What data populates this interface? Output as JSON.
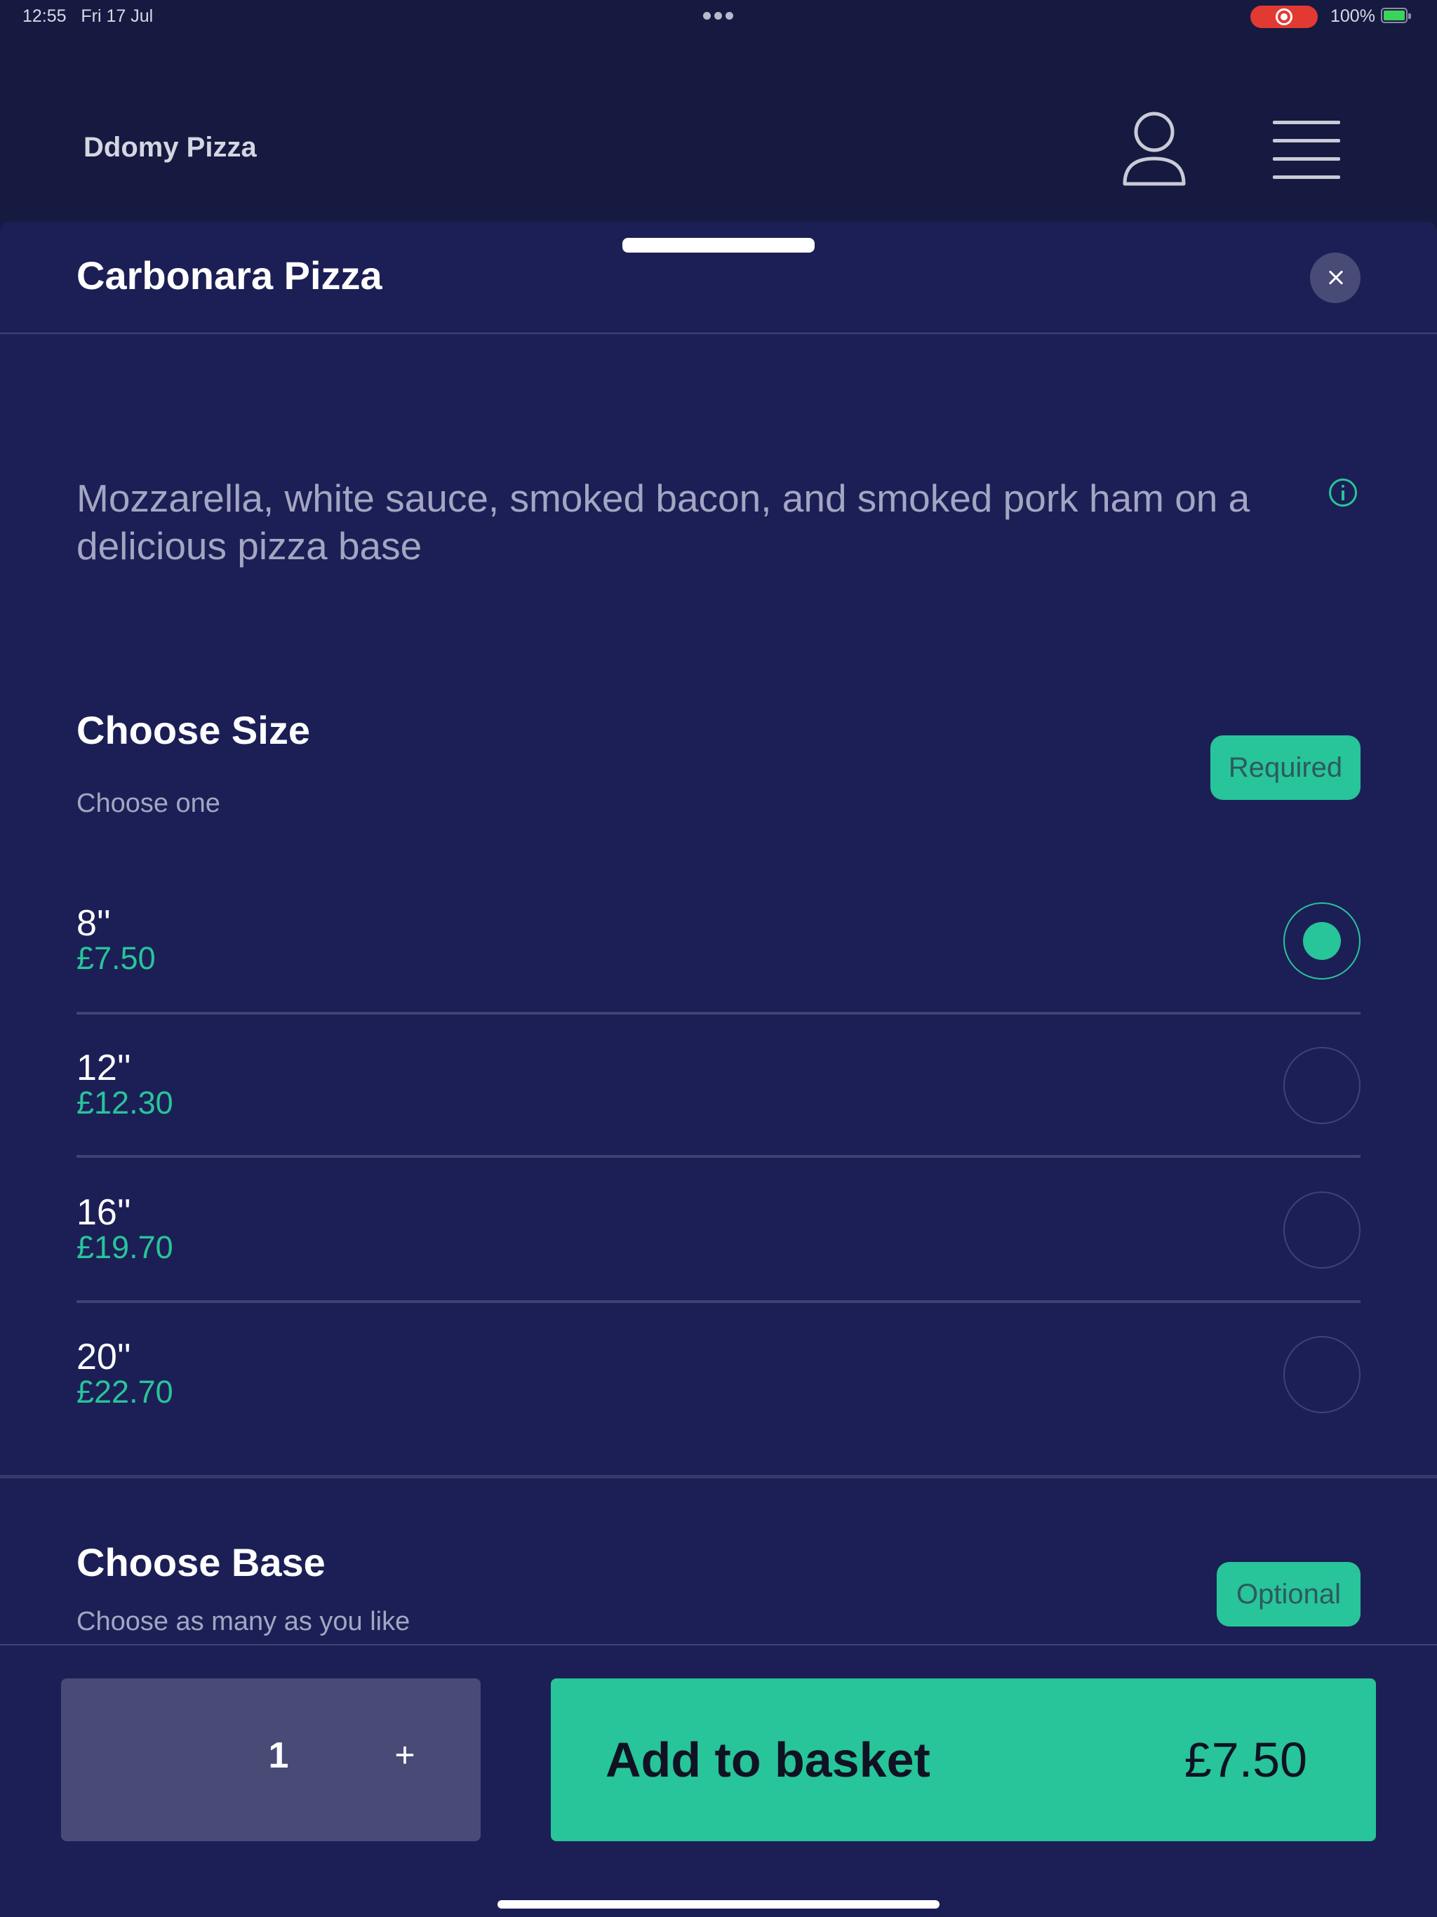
{
  "status_bar": {
    "time": "12:55",
    "date": "Fri 17 Jul",
    "battery_percent": "100%",
    "battery_level": 1.0
  },
  "app": {
    "brand": "Ddomy Pizza",
    "profile_icon": "user-icon",
    "menu_icon": "hamburger-menu-icon"
  },
  "item": {
    "title": "Carbonara Pizza",
    "description": "Mozzarella, white sauce, smoked bacon, and smoked pork ham on a delicious pizza base"
  },
  "size_section": {
    "title": "Choose Size",
    "subtitle": "Choose one",
    "badge": "Required",
    "selected_index": 0,
    "options": [
      {
        "size": "8''",
        "price": "£7.50"
      },
      {
        "size": "12''",
        "price": "£12.30"
      },
      {
        "size": "16''",
        "price": "£19.70"
      },
      {
        "size": "20''",
        "price": "£22.70"
      }
    ]
  },
  "base_section": {
    "title": "Choose Base",
    "subtitle": "Choose as many as you like",
    "badge": "Optional"
  },
  "footer": {
    "quantity": "1",
    "plus_label": "+",
    "add_label": "Add to basket",
    "total_price": "£7.50"
  },
  "colors": {
    "background": "#161a40",
    "sheet": "#1c1f55",
    "accent": "#28c49a",
    "recording": "#e23a33"
  }
}
